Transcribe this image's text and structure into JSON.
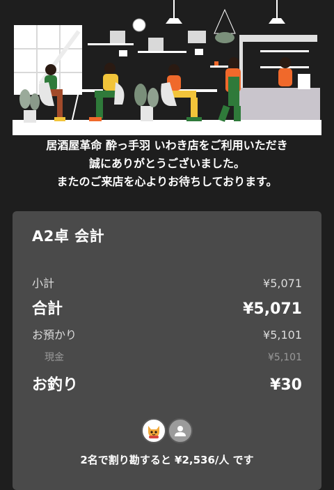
{
  "message": {
    "line1": "居酒屋革命 酔っ手羽 いわき店をご利用いただき",
    "line2": "誠にありがとうございました。",
    "line3": "またのご来店を心よりお待ちしております。"
  },
  "receipt": {
    "title": "A2卓 会計",
    "subtotal": {
      "label": "小計",
      "value": "¥5,071"
    },
    "total": {
      "label": "合計",
      "value": "¥5,071"
    },
    "deposit": {
      "label": "お預かり",
      "value": "¥5,101"
    },
    "cash": {
      "label": "現金",
      "value": "¥5,101"
    },
    "change": {
      "label": "お釣り",
      "value": "¥30"
    }
  },
  "split": {
    "avatars": [
      {
        "icon": "cat-mascot-icon"
      },
      {
        "icon": "user-icon"
      }
    ],
    "text": "2名で割り勘すると ¥2,536/人 です"
  },
  "colors": {
    "background": "#1e1e1e",
    "card": "#4a4a4a",
    "accent_orange": "#f0692b",
    "accent_green": "#2f7a3a"
  }
}
